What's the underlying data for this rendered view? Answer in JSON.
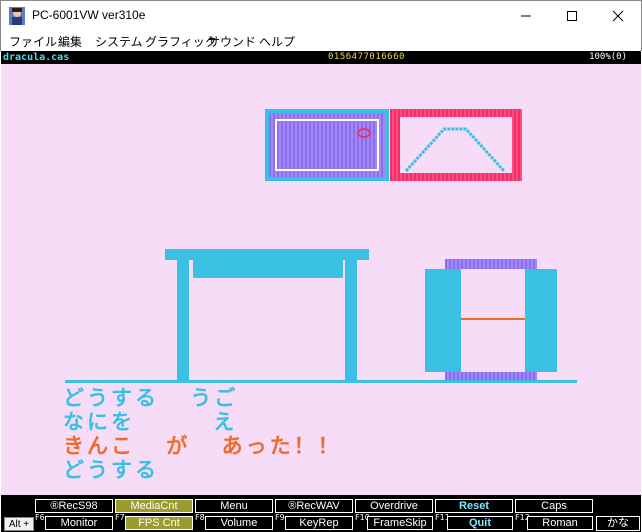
{
  "window": {
    "title": "PC-6001VW ver310e"
  },
  "menu": {
    "items": [
      "ファイル",
      "編集",
      "システム",
      "グラフィック",
      "サウンド",
      "ヘルプ"
    ]
  },
  "status": {
    "filename": "dracula.cas",
    "tape_counter": "0156477016660",
    "zoom": "100%(0)"
  },
  "game": {
    "lines": [
      "どうする  うご",
      "なにを     え",
      "きんこ  が  あった！！",
      "どうする"
    ]
  },
  "fkeys": {
    "top_row": [
      "®RecS98",
      "MediaCnt",
      "Menu",
      "®RecWAV",
      "Overdrive",
      "Reset",
      "Caps"
    ],
    "bottom_row": [
      "Monitor",
      "FPS Cnt",
      "Volume",
      "KeyRep",
      "FrameSkip",
      "Quit",
      "Roman"
    ],
    "numbers": [
      "F6",
      "F7",
      "F8",
      "F9",
      "F10",
      "F11",
      "F12"
    ],
    "alt_label": "Alt +",
    "kana_label": "かな"
  },
  "colors": {
    "screen_bg": "#f7dcf7",
    "cyan": "#3ac0e2",
    "magenta": "#f0306a",
    "purple": "#8c6cf0",
    "orange": "#f06a2a"
  },
  "icons": [
    "app-icon",
    "minimize-icon",
    "maximize-icon",
    "close-icon"
  ]
}
